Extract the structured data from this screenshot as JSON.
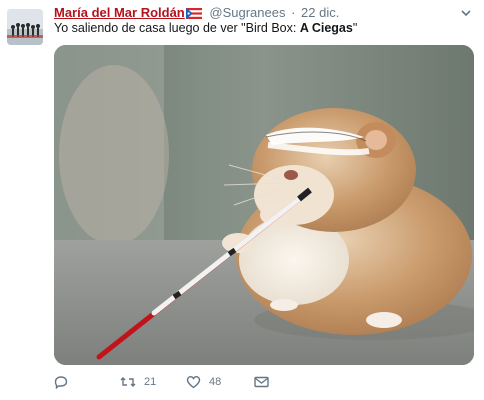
{
  "tweet": {
    "author_name": "María del Mar Roldán",
    "handle": "@Sugranees",
    "separator": "·",
    "time": "22 dic.",
    "text_prefix": "Yo saliendo de casa luego de ver \"Bird Box: ",
    "text_bold": "A Ciegas",
    "text_suffix": "\"",
    "media_icon": "hamster-with-cane-photo",
    "reply_icon": "reply-icon",
    "retweet_count": "21",
    "like_count": "48",
    "colors": {
      "author_name": "#b5121b",
      "muted": "#657786",
      "text": "#14171a"
    }
  }
}
